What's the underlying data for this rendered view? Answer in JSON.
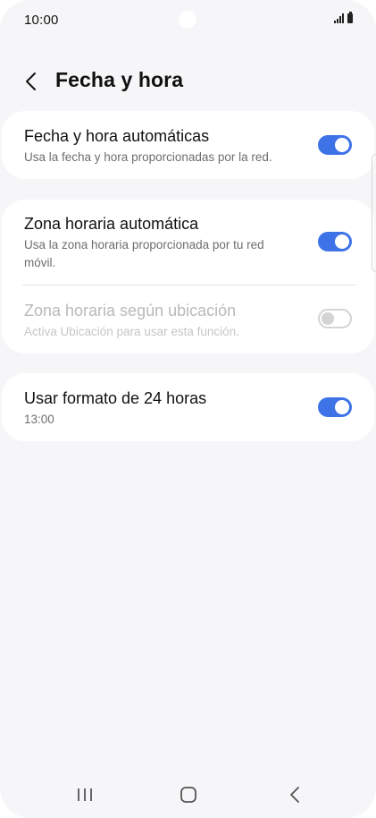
{
  "status_bar": {
    "time": "10:00"
  },
  "header": {
    "title": "Fecha y hora",
    "back_icon": "chevron-left-icon"
  },
  "settings": {
    "auto_datetime": {
      "title": "Fecha y hora automáticas",
      "subtitle": "Usa la fecha y hora proporcionadas por la red.",
      "enabled": true
    },
    "auto_timezone": {
      "title": "Zona horaria automática",
      "subtitle": "Usa la zona horaria proporcionada por tu red móvil.",
      "enabled": true
    },
    "location_timezone": {
      "title": "Zona horaria según ubicación",
      "subtitle": "Activa Ubicación para usar esta función.",
      "enabled": false,
      "disabled": true
    },
    "format_24h": {
      "title": "Usar formato de 24 horas",
      "subtitle": "13:00",
      "enabled": true
    }
  },
  "colors": {
    "accent": "#3e73e8",
    "background": "#f6f6f8",
    "card": "#ffffff"
  },
  "nav_bar": {
    "recents_icon": "recents-icon",
    "home_icon": "home-icon",
    "back_icon": "back-icon"
  }
}
